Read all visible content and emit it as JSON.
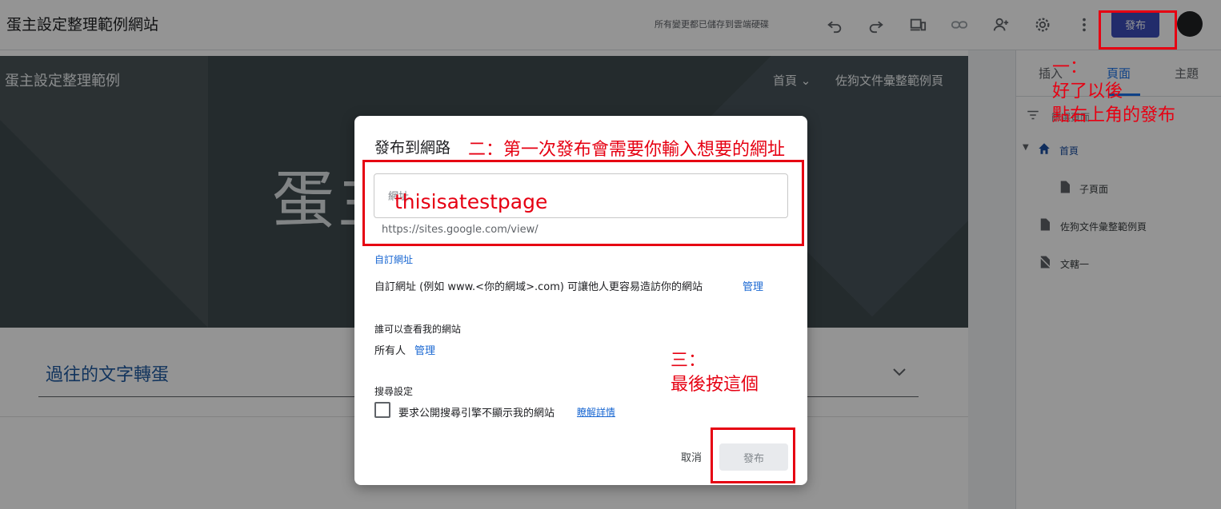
{
  "header": {
    "site_title": "蛋主設定整理範例網站",
    "save_status": "所有變更都已儲存到雲端硬碟",
    "publish_label": "發布",
    "icons": [
      "undo-icon",
      "redo-icon",
      "device-preview-icon",
      "link-icon",
      "add-person-icon",
      "settings-icon",
      "more-vert-icon"
    ]
  },
  "preview": {
    "site_name": "蛋主設定整理範例",
    "nav": [
      {
        "label": "首頁"
      },
      {
        "label": "佐狗文件彙整範例頁"
      }
    ],
    "hero_text": "蛋主",
    "accordion_title": "過往的文字轉蛋"
  },
  "panel": {
    "tabs": [
      {
        "label": "插入"
      },
      {
        "label": "頁面"
      },
      {
        "label": "主題"
      }
    ],
    "active_tab": "頁面",
    "filter_text": "篩選頁面",
    "pages": [
      {
        "label": "首頁",
        "icon": "home-icon"
      },
      {
        "label": "子頁面",
        "icon": "page-icon"
      },
      {
        "label": "佐狗文件彙整範例頁",
        "icon": "page-icon"
      },
      {
        "label": "文轄一",
        "icon": "hidden-page-icon"
      }
    ]
  },
  "dialog": {
    "title": "發布到網路",
    "url_label": "網址",
    "url_value": "thisisatestpage",
    "url_prefix": "https://sites.google.com/view/",
    "custom_url_link": "自訂網址",
    "custom_url_desc": "自訂網址 (例如 www.<你的網域>.com) 可讓他人更容易造訪你的網站",
    "manage_label": "管理",
    "who_can_view_label": "誰可以查看我的網站",
    "everyone_label": "所有人",
    "search_settings_label": "搜尋設定",
    "search_checkbox_label": "要求公開搜尋引擎不顯示我的網站",
    "learn_more": "瞭解詳情",
    "cancel_label": "取消",
    "publish_label": "發布"
  },
  "annotations": {
    "note_one_line1": "一：",
    "note_one_line2": "好了以後",
    "note_one_line3": "點右上角的發布",
    "note_two": "二：第一次發布會需要你輸入想要的網址",
    "note_three_line1": "三：",
    "note_three_line2": "最後按這個"
  },
  "colors": {
    "accent": "#3b4db8",
    "annotation": "#e60012",
    "link": "#1967d2"
  }
}
